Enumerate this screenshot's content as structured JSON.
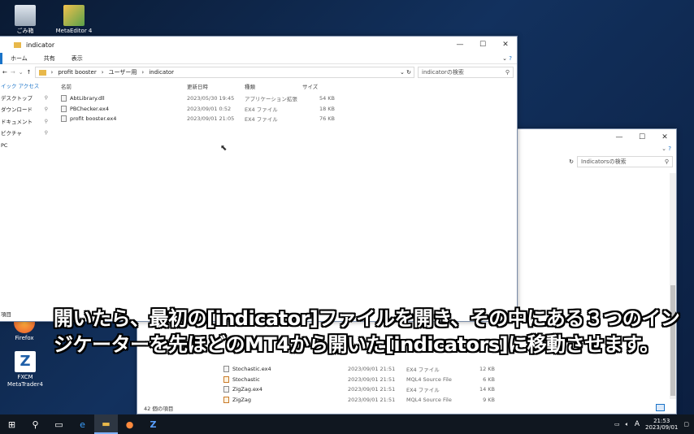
{
  "desktop": {
    "icons": [
      {
        "label": "ごみ箱",
        "icon": "recycle-bin-icon"
      },
      {
        "label": "MetaEditor 4",
        "icon": "metaeditor-icon"
      },
      {
        "label": "Firefox",
        "icon": "firefox-icon"
      },
      {
        "label": "FXCM MetaTrader4",
        "icon": "fxcm-mt4-icon"
      }
    ]
  },
  "front_window": {
    "title": "indicator",
    "ribbon_tabs": [
      "ホーム",
      "共有",
      "表示"
    ],
    "breadcrumb": [
      "profit booster",
      "ユーザー用",
      "indicator"
    ],
    "search_placeholder": "indicatorの検索",
    "nav_items": [
      {
        "label": "イック アクセス",
        "pinned": false
      },
      {
        "label": "デスクトップ",
        "pinned": true
      },
      {
        "label": "ダウンロード",
        "pinned": true
      },
      {
        "label": "ドキュメント",
        "pinned": true
      },
      {
        "label": "ピクチャ",
        "pinned": true
      },
      {
        "label": "PC",
        "pinned": false
      }
    ],
    "nav_footer": "項目",
    "columns": [
      "名前",
      "更新日時",
      "種類",
      "サイズ"
    ],
    "files": [
      {
        "name": "AbtLibrary.dll",
        "date": "2023/05/30 19:45",
        "type": "アプリケーション拡張",
        "size": "54 KB"
      },
      {
        "name": "PBChecker.ex4",
        "date": "2023/09/01 0:52",
        "type": "EX4 ファイル",
        "size": "18 KB"
      },
      {
        "name": "profit booster.ex4",
        "date": "2023/09/01 21:05",
        "type": "EX4 ファイル",
        "size": "76 KB"
      }
    ]
  },
  "back_window": {
    "search_placeholder": "Indicatorsの検索",
    "status": "42 個の項目",
    "files": [
      {
        "name": "Stochastic.ex4",
        "date": "2023/09/01 21:51",
        "type": "EX4 ファイル",
        "size": "12 KB",
        "mql": false
      },
      {
        "name": "Stochastic",
        "date": "2023/09/01 21:51",
        "type": "MQL4 Source File",
        "size": "6 KB",
        "mql": true
      },
      {
        "name": "ZigZag.ex4",
        "date": "2023/09/01 21:51",
        "type": "EX4 ファイル",
        "size": "14 KB",
        "mql": false
      },
      {
        "name": "ZigZag",
        "date": "2023/09/01 21:51",
        "type": "MQL4 Source File",
        "size": "9 KB",
        "mql": true
      }
    ]
  },
  "subtitle": "開いたら、最初の[indicator]ファイルを開き、その中にある３つのインジケーターを先ほどのMT4から開いた[indicators]に移動させます。",
  "taskbar": {
    "time": "21:53",
    "date": "2023/09/01",
    "ime": "A"
  }
}
